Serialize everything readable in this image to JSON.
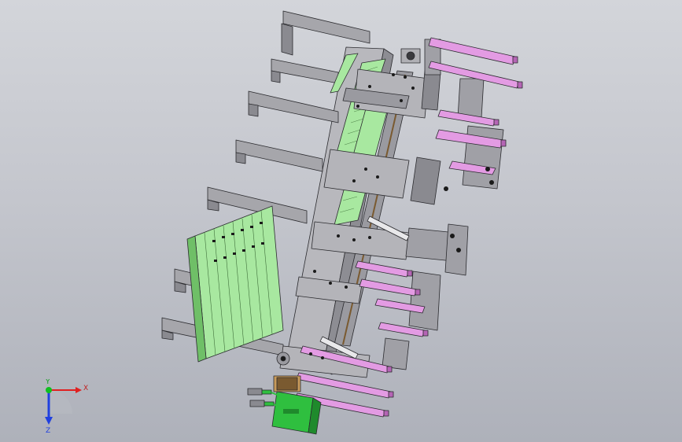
{
  "viewport": {
    "background": {
      "top": "#d3d5da",
      "bottom": "#aeb1ba"
    },
    "model": {
      "colors": {
        "frame": "#a6a6ab",
        "frame_dark": "#6e6e74",
        "frame_light": "#c8c8cc",
        "cylinder": "#e39be3",
        "cylinder_dark": "#b565b5",
        "green_part": "#a8e8a0",
        "green_dark": "#6fbf67",
        "motor": "#2fbf3f",
        "edge": "#2a2a2e"
      }
    }
  },
  "triad": {
    "x_label": "X",
    "y_label": "Y",
    "z_label": "Z",
    "colors": {
      "x": "#e02020",
      "y": "#10c020",
      "z": "#2040e0"
    }
  }
}
